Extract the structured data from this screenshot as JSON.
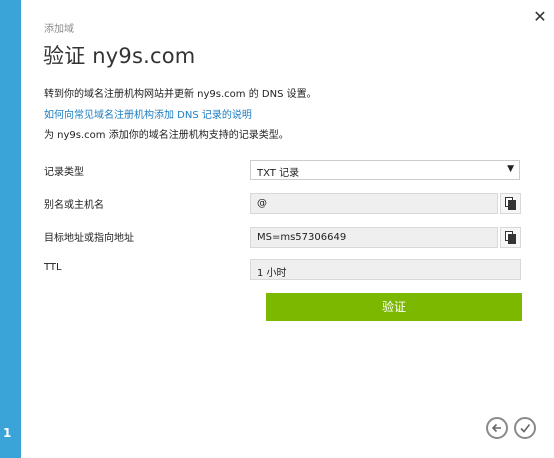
{
  "wizard": {
    "step_number": "1",
    "breadcrumb": "添加域",
    "title": "验证 ny9s.com"
  },
  "instructions": {
    "line1": "转到你的域名注册机构网站并更新 ny9s.com 的 DNS 设置。",
    "help_link": "如何向常见域名注册机构添加 DNS 记录的说明",
    "line2": "为 ny9s.com 添加你的域名注册机构支持的记录类型。"
  },
  "form": {
    "record_type_label": "记录类型",
    "record_type_value": "TXT 记录",
    "alias_label": "别名或主机名",
    "alias_value": "@",
    "target_label": "目标地址或指向地址",
    "target_value": "MS=ms57306649",
    "ttl_label": "TTL",
    "ttl_value": "1 小时"
  },
  "buttons": {
    "verify_label": "验证"
  },
  "icons": {
    "close": "close-icon",
    "copy": "copy-icon",
    "back": "back-arrow-icon",
    "complete": "checkmark-icon",
    "dropdown": "chevron-down-icon"
  },
  "colors": {
    "accent_rail": "#3aa3d8",
    "verify_button": "#7cb800",
    "link": "#1a7dc3"
  }
}
